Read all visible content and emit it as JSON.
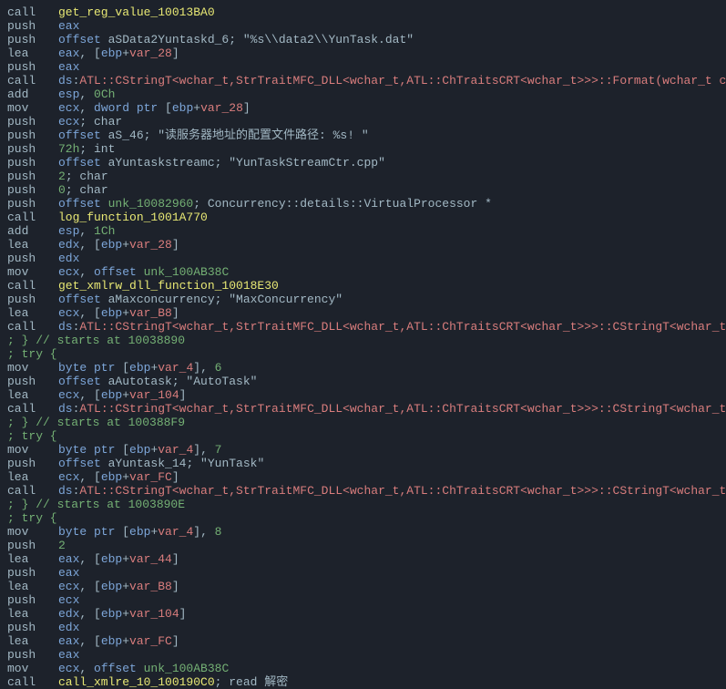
{
  "lines": [
    {
      "type": "instr",
      "mnem": "call",
      "operands": [
        {
          "t": "func",
          "v": "get_reg_value_10013BA0"
        }
      ]
    },
    {
      "type": "instr",
      "mnem": "push",
      "operands": [
        {
          "t": "reg",
          "v": "eax"
        }
      ]
    },
    {
      "type": "instr",
      "mnem": "push",
      "operands": [
        {
          "t": "kw",
          "v": "offset "
        },
        {
          "t": "plain",
          "v": "aSData2Yuntaskd_6"
        }
      ],
      "comment": " ; \"%s\\\\data2\\\\YunTask.dat\""
    },
    {
      "type": "instr",
      "mnem": "lea",
      "operands": [
        {
          "t": "reg",
          "v": "eax"
        },
        {
          "t": "plain",
          "v": ", ["
        },
        {
          "t": "reg",
          "v": "ebp"
        },
        {
          "t": "plain",
          "v": "+"
        },
        {
          "t": "var",
          "v": "var_28"
        },
        {
          "t": "plain",
          "v": "]"
        }
      ]
    },
    {
      "type": "instr",
      "mnem": "push",
      "operands": [
        {
          "t": "reg",
          "v": "eax"
        }
      ]
    },
    {
      "type": "instr",
      "mnem": "call",
      "operands": [
        {
          "t": "reg",
          "v": "ds"
        },
        {
          "t": "plain",
          "v": ":"
        },
        {
          "t": "extcall",
          "v": "ATL::CStringT<wchar_t,StrTraitMFC_DLL<wchar_t,ATL::ChTraitsCRT<wchar_t>>>::Format(wchar_t const *,...)"
        }
      ]
    },
    {
      "type": "instr",
      "mnem": "add",
      "operands": [
        {
          "t": "reg",
          "v": "esp"
        },
        {
          "t": "plain",
          "v": ", "
        },
        {
          "t": "num",
          "v": "0Ch"
        }
      ]
    },
    {
      "type": "instr",
      "mnem": "mov",
      "operands": [
        {
          "t": "reg",
          "v": "ecx"
        },
        {
          "t": "plain",
          "v": ", "
        },
        {
          "t": "kw",
          "v": "dword ptr "
        },
        {
          "t": "plain",
          "v": "["
        },
        {
          "t": "reg",
          "v": "ebp"
        },
        {
          "t": "plain",
          "v": "+"
        },
        {
          "t": "var",
          "v": "var_28"
        },
        {
          "t": "plain",
          "v": "]"
        }
      ]
    },
    {
      "type": "instr",
      "mnem": "push",
      "operands": [
        {
          "t": "reg",
          "v": "ecx"
        }
      ],
      "comment": "            ; char"
    },
    {
      "type": "instr",
      "mnem": "push",
      "operands": [
        {
          "t": "kw",
          "v": "offset "
        },
        {
          "t": "plain",
          "v": "aS_46"
        }
      ],
      "comment": "    ; \"读服务器地址的配置文件路径: %s! \""
    },
    {
      "type": "instr",
      "mnem": "push",
      "operands": [
        {
          "t": "num",
          "v": "72h"
        }
      ],
      "comment": "            ; int"
    },
    {
      "type": "instr",
      "mnem": "push",
      "operands": [
        {
          "t": "kw",
          "v": "offset "
        },
        {
          "t": "plain",
          "v": "aYuntaskstreamc"
        }
      ],
      "comment": " ; \"YunTaskStreamCtr.cpp\""
    },
    {
      "type": "instr",
      "mnem": "push",
      "operands": [
        {
          "t": "num",
          "v": "2"
        }
      ],
      "comment": "              ; char"
    },
    {
      "type": "instr",
      "mnem": "push",
      "operands": [
        {
          "t": "num",
          "v": "0"
        }
      ],
      "comment": "              ; char"
    },
    {
      "type": "instr",
      "mnem": "push",
      "operands": [
        {
          "t": "kw",
          "v": "offset "
        },
        {
          "t": "num",
          "v": "unk_10082960"
        }
      ],
      "comment": " ; Concurrency::details::VirtualProcessor *"
    },
    {
      "type": "instr",
      "mnem": "call",
      "operands": [
        {
          "t": "func",
          "v": "log_function_1001A770"
        }
      ]
    },
    {
      "type": "instr",
      "mnem": "add",
      "operands": [
        {
          "t": "reg",
          "v": "esp"
        },
        {
          "t": "plain",
          "v": ", "
        },
        {
          "t": "num",
          "v": "1Ch"
        }
      ]
    },
    {
      "type": "instr",
      "mnem": "lea",
      "operands": [
        {
          "t": "reg",
          "v": "edx"
        },
        {
          "t": "plain",
          "v": ", ["
        },
        {
          "t": "reg",
          "v": "ebp"
        },
        {
          "t": "plain",
          "v": "+"
        },
        {
          "t": "var",
          "v": "var_28"
        },
        {
          "t": "plain",
          "v": "]"
        }
      ]
    },
    {
      "type": "instr",
      "mnem": "push",
      "operands": [
        {
          "t": "reg",
          "v": "edx"
        }
      ]
    },
    {
      "type": "instr",
      "mnem": "mov",
      "operands": [
        {
          "t": "reg",
          "v": "ecx"
        },
        {
          "t": "plain",
          "v": ", "
        },
        {
          "t": "kw",
          "v": "offset "
        },
        {
          "t": "num",
          "v": "unk_100AB38C"
        }
      ]
    },
    {
      "type": "instr",
      "mnem": "call",
      "operands": [
        {
          "t": "func",
          "v": "get_xmlrw_dll_function_10018E30"
        }
      ]
    },
    {
      "type": "instr",
      "mnem": "push",
      "operands": [
        {
          "t": "kw",
          "v": "offset "
        },
        {
          "t": "plain",
          "v": "aMaxconcurrency"
        }
      ],
      "comment": " ; \"MaxConcurrency\""
    },
    {
      "type": "instr",
      "mnem": "lea",
      "operands": [
        {
          "t": "reg",
          "v": "ecx"
        },
        {
          "t": "plain",
          "v": ", ["
        },
        {
          "t": "reg",
          "v": "ebp"
        },
        {
          "t": "plain",
          "v": "+"
        },
        {
          "t": "var",
          "v": "var_B8"
        },
        {
          "t": "plain",
          "v": "]"
        }
      ]
    },
    {
      "type": "instr",
      "mnem": "call",
      "operands": [
        {
          "t": "reg",
          "v": "ds"
        },
        {
          "t": "plain",
          "v": ":"
        },
        {
          "t": "extcall",
          "v": "ATL::CStringT<wchar_t,StrTraitMFC_DLL<wchar_t,ATL::ChTraitsCRT<wchar_t>>>::CStringT<wchar_t,StrTraitMFC"
        }
      ]
    },
    {
      "type": "try-end",
      "text": ";   } // starts at 10038890"
    },
    {
      "type": "try-start",
      "text": ";   try {"
    },
    {
      "type": "instr",
      "mnem": "mov",
      "operands": [
        {
          "t": "kw",
          "v": "byte ptr "
        },
        {
          "t": "plain",
          "v": "["
        },
        {
          "t": "reg",
          "v": "ebp"
        },
        {
          "t": "plain",
          "v": "+"
        },
        {
          "t": "var",
          "v": "var_4"
        },
        {
          "t": "plain",
          "v": "], "
        },
        {
          "t": "num",
          "v": "6"
        }
      ]
    },
    {
      "type": "instr",
      "mnem": "push",
      "operands": [
        {
          "t": "kw",
          "v": "offset "
        },
        {
          "t": "plain",
          "v": "aAutotask"
        }
      ],
      "comment": " ; \"AutoTask\""
    },
    {
      "type": "instr",
      "mnem": "lea",
      "operands": [
        {
          "t": "reg",
          "v": "ecx"
        },
        {
          "t": "plain",
          "v": ", ["
        },
        {
          "t": "reg",
          "v": "ebp"
        },
        {
          "t": "plain",
          "v": "+"
        },
        {
          "t": "var",
          "v": "var_104"
        },
        {
          "t": "plain",
          "v": "]"
        }
      ]
    },
    {
      "type": "instr",
      "mnem": "call",
      "operands": [
        {
          "t": "reg",
          "v": "ds"
        },
        {
          "t": "plain",
          "v": ":"
        },
        {
          "t": "extcall",
          "v": "ATL::CStringT<wchar_t,StrTraitMFC_DLL<wchar_t,ATL::ChTraitsCRT<wchar_t>>>::CStringT<wchar_t,StrTraitMFC"
        }
      ]
    },
    {
      "type": "try-end",
      "text": ";   } // starts at 100388F9"
    },
    {
      "type": "try-start",
      "text": ";   try {"
    },
    {
      "type": "instr",
      "mnem": "mov",
      "operands": [
        {
          "t": "kw",
          "v": "byte ptr "
        },
        {
          "t": "plain",
          "v": "["
        },
        {
          "t": "reg",
          "v": "ebp"
        },
        {
          "t": "plain",
          "v": "+"
        },
        {
          "t": "var",
          "v": "var_4"
        },
        {
          "t": "plain",
          "v": "], "
        },
        {
          "t": "num",
          "v": "7"
        }
      ]
    },
    {
      "type": "instr",
      "mnem": "push",
      "operands": [
        {
          "t": "kw",
          "v": "offset "
        },
        {
          "t": "plain",
          "v": "aYuntask_14"
        }
      ],
      "comment": " ; \"YunTask\""
    },
    {
      "type": "instr",
      "mnem": "lea",
      "operands": [
        {
          "t": "reg",
          "v": "ecx"
        },
        {
          "t": "plain",
          "v": ", ["
        },
        {
          "t": "reg",
          "v": "ebp"
        },
        {
          "t": "plain",
          "v": "+"
        },
        {
          "t": "var",
          "v": "var_FC"
        },
        {
          "t": "plain",
          "v": "]"
        }
      ]
    },
    {
      "type": "instr",
      "mnem": "call",
      "operands": [
        {
          "t": "reg",
          "v": "ds"
        },
        {
          "t": "plain",
          "v": ":"
        },
        {
          "t": "extcall",
          "v": "ATL::CStringT<wchar_t,StrTraitMFC_DLL<wchar_t,ATL::ChTraitsCRT<wchar_t>>>::CStringT<wchar_t,StrTraitMFC"
        }
      ]
    },
    {
      "type": "try-end",
      "text": ";   } // starts at 1003890E"
    },
    {
      "type": "try-start",
      "text": ";   try {"
    },
    {
      "type": "instr",
      "mnem": "mov",
      "operands": [
        {
          "t": "kw",
          "v": "byte ptr "
        },
        {
          "t": "plain",
          "v": "["
        },
        {
          "t": "reg",
          "v": "ebp"
        },
        {
          "t": "plain",
          "v": "+"
        },
        {
          "t": "var",
          "v": "var_4"
        },
        {
          "t": "plain",
          "v": "], "
        },
        {
          "t": "num",
          "v": "8"
        }
      ]
    },
    {
      "type": "instr",
      "mnem": "push",
      "operands": [
        {
          "t": "num",
          "v": "2"
        }
      ]
    },
    {
      "type": "instr",
      "mnem": "lea",
      "operands": [
        {
          "t": "reg",
          "v": "eax"
        },
        {
          "t": "plain",
          "v": ", ["
        },
        {
          "t": "reg",
          "v": "ebp"
        },
        {
          "t": "plain",
          "v": "+"
        },
        {
          "t": "var",
          "v": "var_44"
        },
        {
          "t": "plain",
          "v": "]"
        }
      ]
    },
    {
      "type": "instr",
      "mnem": "push",
      "operands": [
        {
          "t": "reg",
          "v": "eax"
        }
      ]
    },
    {
      "type": "instr",
      "mnem": "lea",
      "operands": [
        {
          "t": "reg",
          "v": "ecx"
        },
        {
          "t": "plain",
          "v": ", ["
        },
        {
          "t": "reg",
          "v": "ebp"
        },
        {
          "t": "plain",
          "v": "+"
        },
        {
          "t": "var",
          "v": "var_B8"
        },
        {
          "t": "plain",
          "v": "]"
        }
      ]
    },
    {
      "type": "instr",
      "mnem": "push",
      "operands": [
        {
          "t": "reg",
          "v": "ecx"
        }
      ]
    },
    {
      "type": "instr",
      "mnem": "lea",
      "operands": [
        {
          "t": "reg",
          "v": "edx"
        },
        {
          "t": "plain",
          "v": ", ["
        },
        {
          "t": "reg",
          "v": "ebp"
        },
        {
          "t": "plain",
          "v": "+"
        },
        {
          "t": "var",
          "v": "var_104"
        },
        {
          "t": "plain",
          "v": "]"
        }
      ]
    },
    {
      "type": "instr",
      "mnem": "push",
      "operands": [
        {
          "t": "reg",
          "v": "edx"
        }
      ]
    },
    {
      "type": "instr",
      "mnem": "lea",
      "operands": [
        {
          "t": "reg",
          "v": "eax"
        },
        {
          "t": "plain",
          "v": ", ["
        },
        {
          "t": "reg",
          "v": "ebp"
        },
        {
          "t": "plain",
          "v": "+"
        },
        {
          "t": "var",
          "v": "var_FC"
        },
        {
          "t": "plain",
          "v": "]"
        }
      ]
    },
    {
      "type": "instr",
      "mnem": "push",
      "operands": [
        {
          "t": "reg",
          "v": "eax"
        }
      ]
    },
    {
      "type": "instr",
      "mnem": "mov",
      "operands": [
        {
          "t": "reg",
          "v": "ecx"
        },
        {
          "t": "plain",
          "v": ", "
        },
        {
          "t": "kw",
          "v": "offset "
        },
        {
          "t": "num",
          "v": "unk_100AB38C"
        }
      ]
    },
    {
      "type": "instr",
      "mnem": "call",
      "operands": [
        {
          "t": "func",
          "v": "call_xmlre_10_100190C0"
        }
      ],
      "comment": " ; read 解密"
    }
  ]
}
